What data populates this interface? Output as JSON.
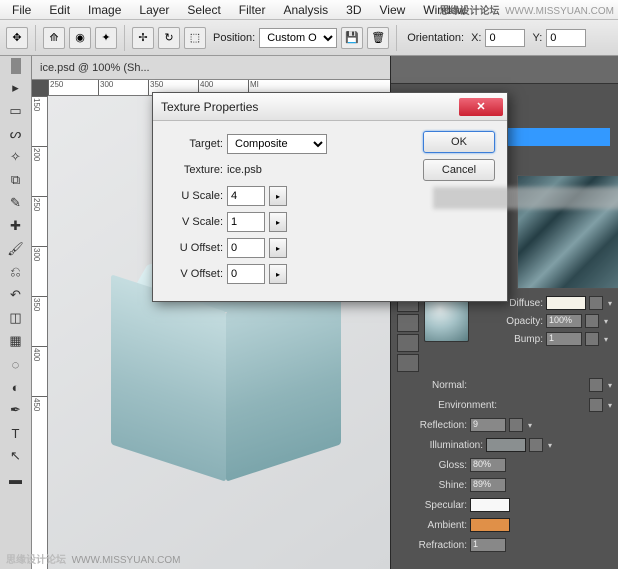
{
  "menu": [
    "File",
    "Edit",
    "Image",
    "Layer",
    "Select",
    "Filter",
    "Analysis",
    "3D",
    "View",
    "Window"
  ],
  "watermark": {
    "cn": "思缘设计论坛",
    "url": "WWW.MISSYUAN.COM"
  },
  "optbar": {
    "position_label": "Position:",
    "position_value": "Custom Ob...",
    "orientation_label": "Orientation:",
    "x_label": "X:",
    "x_value": "0",
    "y_label": "Y:",
    "y_value": "0"
  },
  "doc": {
    "title": "ice.psd @ 100% (Sh..."
  },
  "ruler_h": [
    "250",
    "300",
    "350",
    "400",
    "MI"
  ],
  "ruler_v": [
    "150",
    "200",
    "250",
    "300",
    "350",
    "400",
    "450"
  ],
  "dialog": {
    "title": "Texture Properties",
    "ok": "OK",
    "cancel": "Cancel",
    "target_label": "Target:",
    "target_value": "Composite",
    "texture_label": "Texture:",
    "texture_value": "ice.psb",
    "uscale_label": "U Scale:",
    "uscale_value": "4",
    "vscale_label": "V Scale:",
    "vscale_value": "1",
    "uoffset_label": "U Offset:",
    "uoffset_value": "0",
    "voffset_label": "V Offset:",
    "voffset_value": "0"
  },
  "material": {
    "diffuse": {
      "label": "Diffuse:",
      "color": "#f5f2e8"
    },
    "opacity": {
      "label": "Opacity:",
      "value": "100%"
    },
    "bump": {
      "label": "Bump:",
      "value": "1"
    },
    "normal": {
      "label": "Normal:"
    },
    "environment": {
      "label": "Environment:"
    },
    "reflection": {
      "label": "Reflection:",
      "value": "9"
    },
    "illumination": {
      "label": "Illumination:",
      "color": "#8a8f90"
    },
    "gloss": {
      "label": "Gloss:",
      "value": "80%"
    },
    "shine": {
      "label": "Shine:",
      "value": "89%"
    },
    "specular": {
      "label": "Specular:",
      "color": "#f8f8f8"
    },
    "ambient": {
      "label": "Ambient:",
      "color": "#e09048"
    },
    "refraction": {
      "label": "Refraction:",
      "value": "1"
    }
  }
}
